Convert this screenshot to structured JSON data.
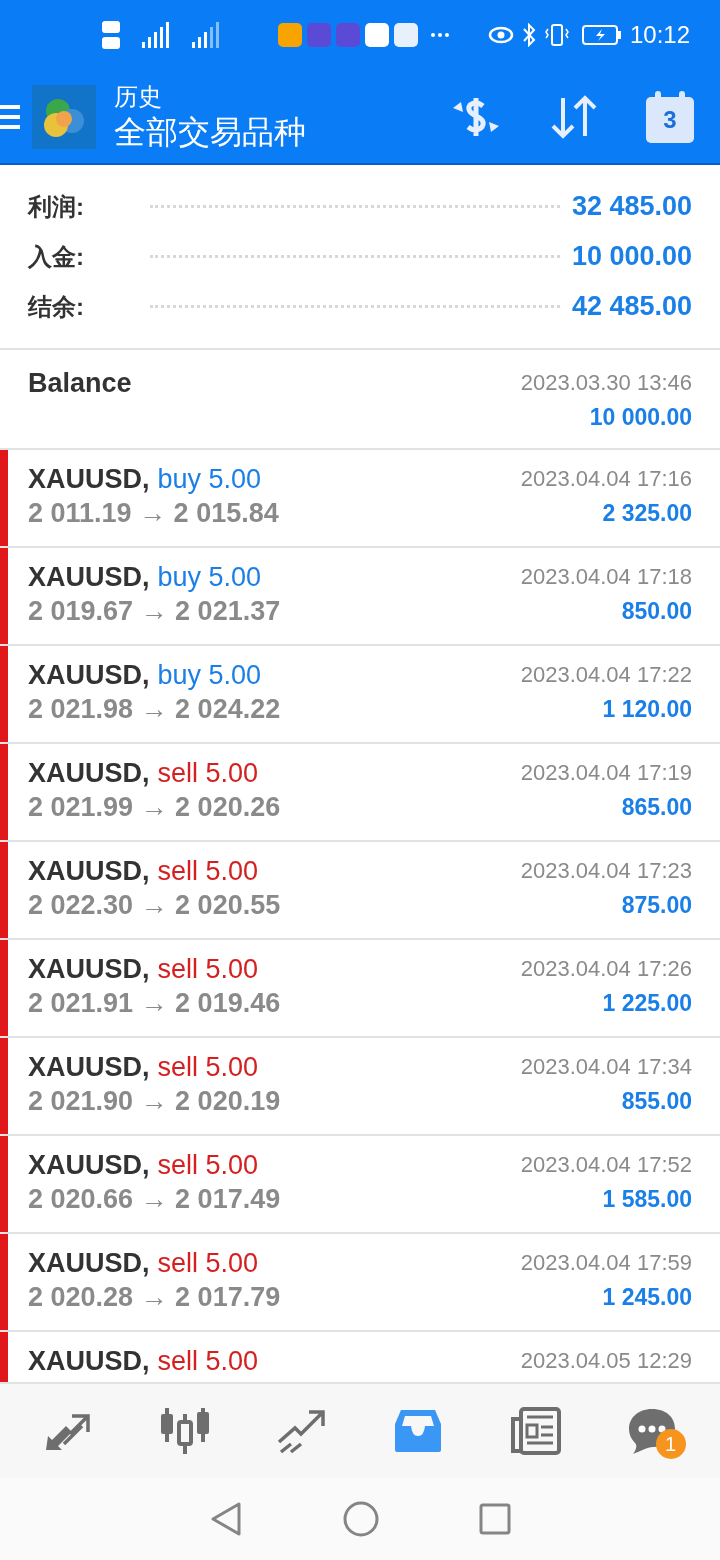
{
  "status_bar": {
    "time": "10:12"
  },
  "header": {
    "title": "历史",
    "subtitle": "全部交易品种",
    "calendar_day": "3"
  },
  "summary": [
    {
      "label": "利润:",
      "value": "32 485.00"
    },
    {
      "label": "入金:",
      "value": "10 000.00"
    },
    {
      "label": "结余:",
      "value": "42 485.00"
    }
  ],
  "balance": {
    "label": "Balance",
    "time": "2023.03.30 13:46",
    "amount": "10 000.00"
  },
  "trades": [
    {
      "symbol": "XAUUSD,",
      "side": "buy",
      "volume": "5.00",
      "prices": "2 011.19 → 2 015.84",
      "time": "2023.04.04 17:16",
      "profit": "2 325.00"
    },
    {
      "symbol": "XAUUSD,",
      "side": "buy",
      "volume": "5.00",
      "prices": "2 019.67 → 2 021.37",
      "time": "2023.04.04 17:18",
      "profit": "850.00"
    },
    {
      "symbol": "XAUUSD,",
      "side": "buy",
      "volume": "5.00",
      "prices": "2 021.98 → 2 024.22",
      "time": "2023.04.04 17:22",
      "profit": "1 120.00"
    },
    {
      "symbol": "XAUUSD,",
      "side": "sell",
      "volume": "5.00",
      "prices": "2 021.99 → 2 020.26",
      "time": "2023.04.04 17:19",
      "profit": "865.00"
    },
    {
      "symbol": "XAUUSD,",
      "side": "sell",
      "volume": "5.00",
      "prices": "2 022.30 → 2 020.55",
      "time": "2023.04.04 17:23",
      "profit": "875.00"
    },
    {
      "symbol": "XAUUSD,",
      "side": "sell",
      "volume": "5.00",
      "prices": "2 021.91 → 2 019.46",
      "time": "2023.04.04 17:26",
      "profit": "1 225.00"
    },
    {
      "symbol": "XAUUSD,",
      "side": "sell",
      "volume": "5.00",
      "prices": "2 021.90 → 2 020.19",
      "time": "2023.04.04 17:34",
      "profit": "855.00"
    },
    {
      "symbol": "XAUUSD,",
      "side": "sell",
      "volume": "5.00",
      "prices": "2 020.66 → 2 017.49",
      "time": "2023.04.04 17:52",
      "profit": "1 585.00"
    },
    {
      "symbol": "XAUUSD,",
      "side": "sell",
      "volume": "5.00",
      "prices": "2 020.28 → 2 017.79",
      "time": "2023.04.04 17:59",
      "profit": "1 245.00"
    },
    {
      "symbol": "XAUUSD,",
      "side": "sell",
      "volume": "5.00",
      "time": "2023.04.05 12:29"
    }
  ],
  "tab_bar": {
    "items": [
      {
        "selected": false
      },
      {
        "selected": false
      },
      {
        "selected": false
      },
      {
        "selected": true
      },
      {
        "selected": false
      },
      {
        "selected": false,
        "badge": "1"
      }
    ]
  }
}
